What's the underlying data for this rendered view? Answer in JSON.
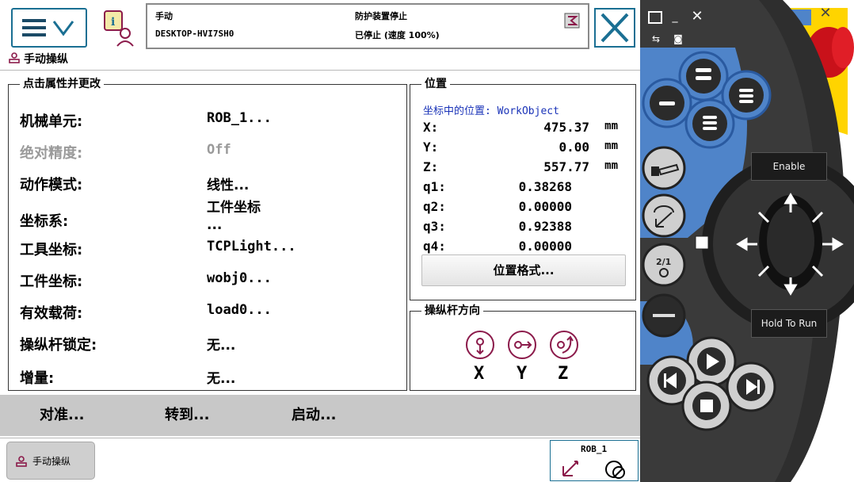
{
  "status": {
    "mode": "手动",
    "system_name": "DESKTOP-HVI7SH0",
    "state": "防护装置停止",
    "speed": "已停止 (速度 100%)"
  },
  "app_title": "手动操纵",
  "properties": {
    "legend": "点击属性并更改",
    "rows": [
      {
        "label": "机械单元:",
        "value": "ROB_1..."
      },
      {
        "label": "绝对精度:",
        "value": "Off"
      },
      {
        "label": "动作模式:",
        "value": "线性..."
      },
      {
        "label": "坐标系:",
        "value": "工件坐标",
        "value2": "..."
      },
      {
        "label": "工具坐标:",
        "value": "TCPLight..."
      },
      {
        "label": "工件坐标:",
        "value": "wobj0..."
      },
      {
        "label": "有效载荷:",
        "value": "load0..."
      },
      {
        "label": "操纵杆锁定:",
        "value": "无..."
      },
      {
        "label": "增量:",
        "value": "无..."
      }
    ]
  },
  "position": {
    "legend": "位置",
    "coord_label": "坐标中的位置: WorkObject",
    "rows": [
      {
        "key": "X:",
        "value": "475.37",
        "unit": "mm"
      },
      {
        "key": "Y:",
        "value": "0.00",
        "unit": "mm"
      },
      {
        "key": "Z:",
        "value": "557.77",
        "unit": "mm"
      },
      {
        "key": "q1:",
        "value": "0.38268",
        "unit": ""
      },
      {
        "key": "q2:",
        "value": "0.00000",
        "unit": ""
      },
      {
        "key": "q3:",
        "value": "0.92388",
        "unit": ""
      },
      {
        "key": "q4:",
        "value": "0.00000",
        "unit": ""
      }
    ],
    "format_button": "位置格式..."
  },
  "joystick": {
    "legend": "操纵杆方向",
    "axes": [
      "X",
      "Y",
      "Z"
    ]
  },
  "bottom_bar": {
    "align": "对准...",
    "goto": "转到...",
    "start": "启动..."
  },
  "taskbar": {
    "jog_task": "手动操纵",
    "mech_unit": "ROB_1"
  },
  "device": {
    "enable_label": "Enable",
    "hold_label": "Hold To Run"
  },
  "colors": {
    "accent": "#1a6f93",
    "device_blue": "#4f84c9",
    "jog_purple": "#8b1a4a",
    "coord_blue": "#1a33b8"
  }
}
